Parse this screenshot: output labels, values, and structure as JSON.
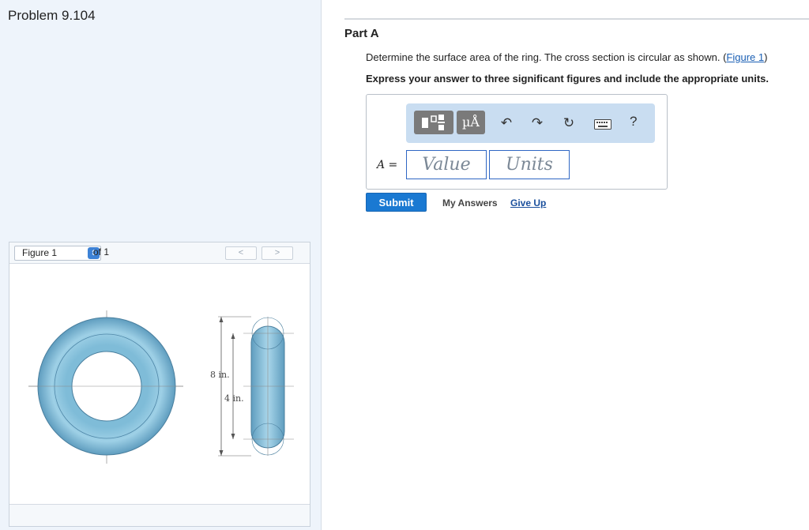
{
  "problem": {
    "title": "Problem 9.104"
  },
  "figure": {
    "selector_label": "Figure 1",
    "of_label": "of 1",
    "prev_label": "<",
    "next_label": ">",
    "dim_outer": "8 in.",
    "dim_inner": "4 in."
  },
  "part": {
    "title": "Part A",
    "question_text": "Determine the surface area of the ring. The cross section is circular as shown. (",
    "figure_link": "Figure 1",
    "question_close": ")",
    "instruction": "Express your answer to three significant figures and include the appropriate units."
  },
  "answer": {
    "variable_label": "A =",
    "value_placeholder": "Value",
    "units_placeholder": "Units",
    "toolbar": {
      "units_button": "µÅ",
      "undo_icon": "undo-icon",
      "redo_icon": "redo-icon",
      "reset_icon": "reset-icon",
      "keyboard_icon": "keyboard-icon",
      "help_label": "?"
    }
  },
  "actions": {
    "submit": "Submit",
    "my_answers": "My Answers",
    "give_up": "Give Up"
  },
  "colors": {
    "ring": "#8cc3dd",
    "ring_dark": "#5b93b3",
    "accent": "#1a79d2",
    "link": "#1a5fb4"
  }
}
